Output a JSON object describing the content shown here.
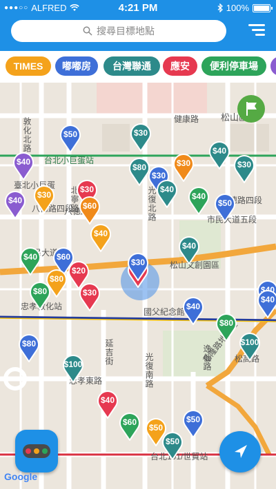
{
  "status_bar": {
    "carrier": "ALFRED",
    "time": "4:21 PM",
    "battery": "100%"
  },
  "search": {
    "placeholder": "搜尋目標地點"
  },
  "filters": [
    {
      "label": "TIMES",
      "color": "#f4a21b"
    },
    {
      "label": "嘟嘟房",
      "color": "#3e6fd8"
    },
    {
      "label": "台灣聯通",
      "color": "#2d8a8a"
    },
    {
      "label": "應安",
      "color": "#e63950"
    },
    {
      "label": "便利停車場",
      "color": "#2da45a"
    }
  ],
  "map": {
    "street_labels": [
      "健康路",
      "松山區",
      "敦化北路",
      "台北小巨蛋站",
      "臺北小巨蛋",
      "八德路四段",
      "北寧路",
      "八德路",
      "光復北路",
      "八德路四段",
      "市民大道五段",
      "市民大道",
      "松山文創園區",
      "國父紀念館",
      "忠孝敦化站",
      "延吉街",
      "光復南路",
      "逸仙路",
      "基隆路地下道",
      "松高路",
      "忠孝東路",
      "台北101/世貿站"
    ],
    "pins": [
      {
        "price": "$50",
        "color": "#3e6fd8"
      },
      {
        "price": "$30",
        "color": "#2d8a8a"
      },
      {
        "price": "$40",
        "color": "#8a5cd0"
      },
      {
        "price": "$40",
        "color": "#2d8a8a"
      },
      {
        "price": "$80",
        "color": "#2d8a8a"
      },
      {
        "price": "$30",
        "color": "#f08a1a"
      },
      {
        "price": "$30",
        "color": "#3e6fd8"
      },
      {
        "price": "$40",
        "color": "#2d8a8a"
      },
      {
        "price": "$30",
        "color": "#2d8a8a"
      },
      {
        "price": "$30",
        "color": "#e63950"
      },
      {
        "price": "$60",
        "color": "#f08a1a"
      },
      {
        "price": "$40",
        "color": "#2da45a"
      },
      {
        "price": "$50",
        "color": "#3e6fd8"
      },
      {
        "price": "$40",
        "color": "#8a5cd0"
      },
      {
        "price": "$30",
        "color": "#f4a21b"
      },
      {
        "price": "$40",
        "color": "#f4a21b"
      },
      {
        "price": "$40",
        "color": "#2d8a8a"
      },
      {
        "price": "$40",
        "color": "#2da45a"
      },
      {
        "price": "$60",
        "color": "#3e6fd8"
      },
      {
        "price": "$80",
        "color": "#f4a21b"
      },
      {
        "price": "$20",
        "color": "#e63950"
      },
      {
        "price": "$30",
        "color": "#e63950"
      },
      {
        "price": "$80",
        "color": "#2da45a"
      },
      {
        "price": "$30",
        "color": "#e63950"
      },
      {
        "price": "$40",
        "color": "#3e6fd8"
      },
      {
        "price": "$40",
        "color": "#3e6fd8"
      },
      {
        "price": "$80",
        "color": "#2da45a"
      },
      {
        "price": "$100",
        "color": "#2d8a8a"
      },
      {
        "price": "$80",
        "color": "#3e6fd8"
      },
      {
        "price": "$100",
        "color": "#2d8a8a"
      },
      {
        "price": "$40",
        "color": "#e63950"
      },
      {
        "price": "$60",
        "color": "#2da45a"
      },
      {
        "price": "$50",
        "color": "#f4a21b"
      },
      {
        "price": "$50",
        "color": "#3e6fd8"
      },
      {
        "price": "$50",
        "color": "#2d8a8a"
      },
      {
        "price": "$40",
        "color": "#3e6fd8"
      },
      {
        "price": "$30",
        "color": "#3e6fd8"
      }
    ],
    "signal_colors": [
      "#e63950",
      "#f4a21b",
      "#2da45a"
    ],
    "attribution": "Google"
  },
  "icons": {
    "search": "search-icon",
    "menu": "hamburger-menu-icon",
    "locate": "navigation-arrow-icon",
    "flag": "flag-report-icon"
  }
}
